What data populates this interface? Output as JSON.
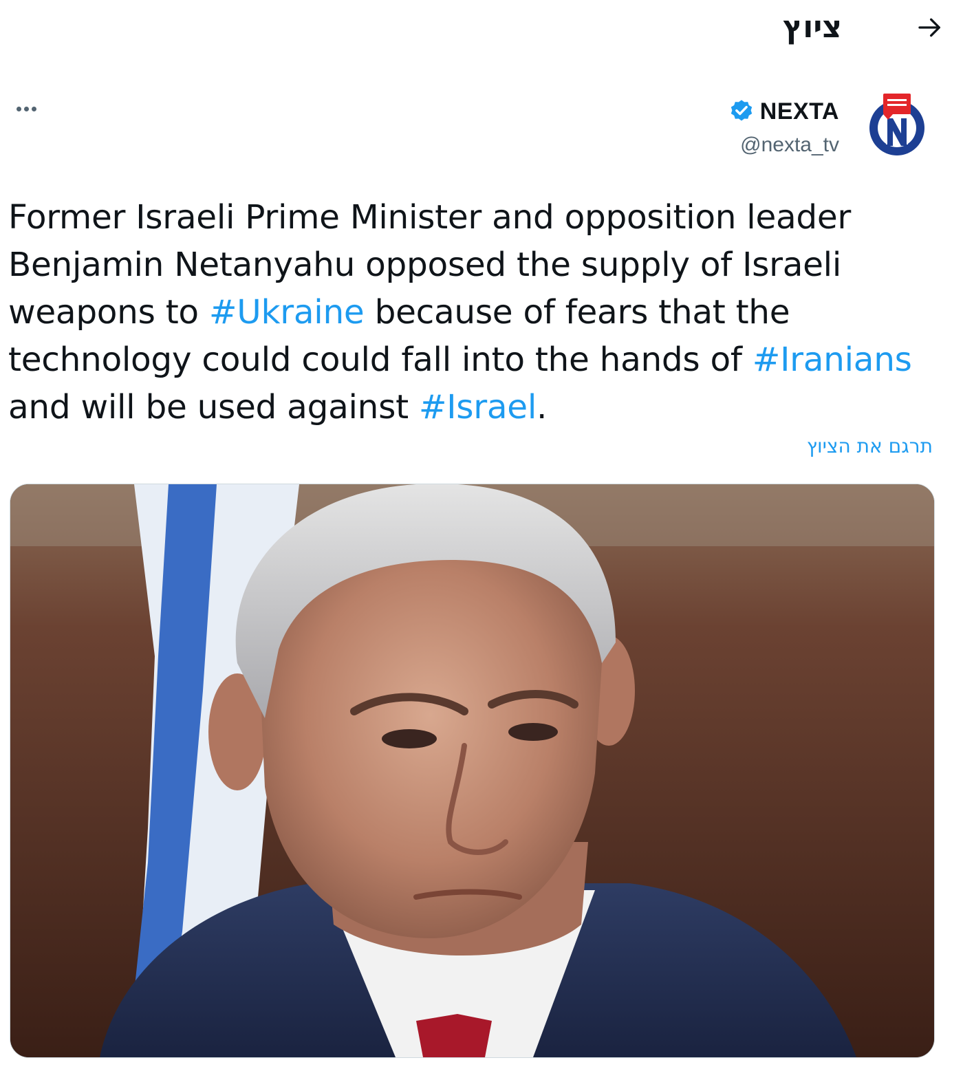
{
  "header": {
    "title": "ציוץ",
    "back_icon": "arrow-right-icon"
  },
  "tweet": {
    "author": {
      "display_name": "NEXTA",
      "handle": "@nexta_tv",
      "verified": true,
      "avatar_icon": "nexta-logo-icon"
    },
    "more_icon": "more-options-icon",
    "text_segments": [
      {
        "type": "text",
        "value": "Former Israeli Prime Minister and opposition leader Benjamin Netanyahu opposed the supply of Israeli weapons to "
      },
      {
        "type": "hashtag",
        "value": "#Ukraine"
      },
      {
        "type": "text",
        "value": " because of fears that the technology could could fall into the hands of "
      },
      {
        "type": "hashtag",
        "value": "#Iranians"
      },
      {
        "type": "text",
        "value": " and will be used against "
      },
      {
        "type": "hashtag",
        "value": "#Israel"
      },
      {
        "type": "text",
        "value": "."
      }
    ],
    "translate_label": "תרגם את הציוץ"
  },
  "colors": {
    "link": "#1d9bf0",
    "text": "#0f1419",
    "secondary": "#536471",
    "nexta_blue": "#1d3f93",
    "nexta_red": "#e3262a"
  }
}
